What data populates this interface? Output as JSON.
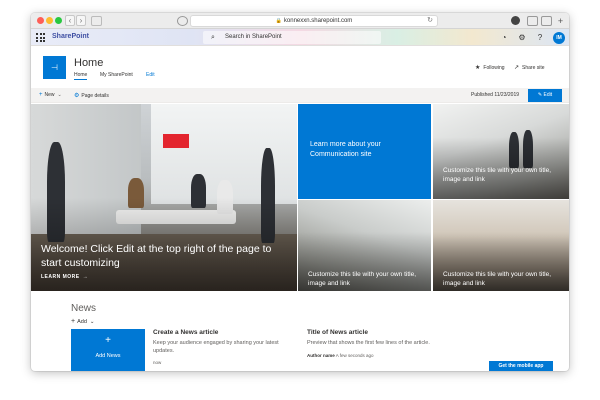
{
  "browser": {
    "address": "konnexxn.sharepoint.com"
  },
  "suite": {
    "app_name": "SharePoint",
    "search_placeholder": "Search in SharePoint",
    "avatar_initials": "IM"
  },
  "site": {
    "title": "Home",
    "nav": [
      "Home",
      "My SharePoint",
      "Edit"
    ],
    "following_label": "Following",
    "share_label": "Share site"
  },
  "command_bar": {
    "new_label": "New",
    "page_details_label": "Page details",
    "published": "Published 11/23/2019",
    "edit_label": "Edit"
  },
  "hero": {
    "main_caption": "Welcome! Click Edit at the top right of the page to start customizing",
    "learn_more": "LEARN MORE",
    "blue_tile": "Learn more about your Communication site",
    "tiles": [
      "Customize this tile with your own title, image and link",
      "Customize this tile with your own title, image and link",
      "Customize this tile with your own title, image and link"
    ]
  },
  "news": {
    "title": "News",
    "add_label": "Add",
    "add_news_label": "Add News",
    "articles": [
      {
        "title": "Create a News article",
        "body": "Keep your audience engaged by sharing your latest updates.",
        "meta_label": "now",
        "meta_author": ""
      },
      {
        "title": "Title of News article",
        "body": "Preview that shows the first few lines of the article.",
        "meta_author": "Author name",
        "meta_label": "A few seconds ago"
      }
    ],
    "mobile_button": "Get the mobile app"
  },
  "colors": {
    "accent": "#0078d4",
    "sharepoint_brand": "#3f4fa3"
  }
}
